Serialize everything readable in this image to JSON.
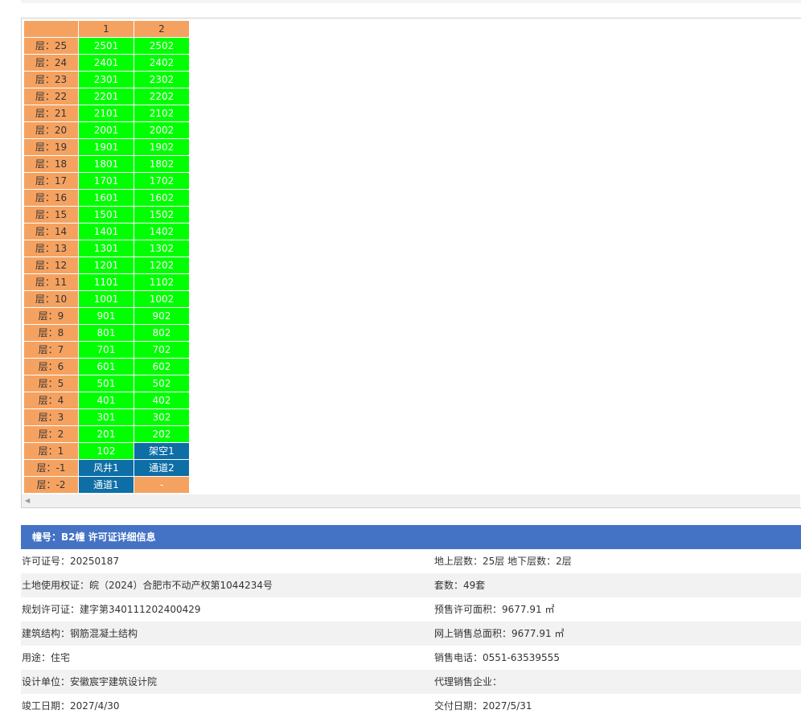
{
  "grid": {
    "column_headers": [
      "",
      "1",
      "2"
    ],
    "colors": {
      "floor": "#f5a261",
      "available": "#00ff00",
      "other": "#0e6ea6",
      "empty": "#f5a261"
    },
    "rows": [
      {
        "floor": "层：25",
        "units": [
          {
            "text": "2501",
            "status": "available"
          },
          {
            "text": "2502",
            "status": "available"
          }
        ]
      },
      {
        "floor": "层：24",
        "units": [
          {
            "text": "2401",
            "status": "available"
          },
          {
            "text": "2402",
            "status": "available"
          }
        ]
      },
      {
        "floor": "层：23",
        "units": [
          {
            "text": "2301",
            "status": "available"
          },
          {
            "text": "2302",
            "status": "available"
          }
        ]
      },
      {
        "floor": "层：22",
        "units": [
          {
            "text": "2201",
            "status": "available"
          },
          {
            "text": "2202",
            "status": "available"
          }
        ]
      },
      {
        "floor": "层：21",
        "units": [
          {
            "text": "2101",
            "status": "available"
          },
          {
            "text": "2102",
            "status": "available"
          }
        ]
      },
      {
        "floor": "层：20",
        "units": [
          {
            "text": "2001",
            "status": "available"
          },
          {
            "text": "2002",
            "status": "available"
          }
        ]
      },
      {
        "floor": "层：19",
        "units": [
          {
            "text": "1901",
            "status": "available"
          },
          {
            "text": "1902",
            "status": "available"
          }
        ]
      },
      {
        "floor": "层：18",
        "units": [
          {
            "text": "1801",
            "status": "available"
          },
          {
            "text": "1802",
            "status": "available"
          }
        ]
      },
      {
        "floor": "层：17",
        "units": [
          {
            "text": "1701",
            "status": "available"
          },
          {
            "text": "1702",
            "status": "available"
          }
        ]
      },
      {
        "floor": "层：16",
        "units": [
          {
            "text": "1601",
            "status": "available"
          },
          {
            "text": "1602",
            "status": "available"
          }
        ]
      },
      {
        "floor": "层：15",
        "units": [
          {
            "text": "1501",
            "status": "available"
          },
          {
            "text": "1502",
            "status": "available"
          }
        ]
      },
      {
        "floor": "层：14",
        "units": [
          {
            "text": "1401",
            "status": "available"
          },
          {
            "text": "1402",
            "status": "available"
          }
        ]
      },
      {
        "floor": "层：13",
        "units": [
          {
            "text": "1301",
            "status": "available"
          },
          {
            "text": "1302",
            "status": "available"
          }
        ]
      },
      {
        "floor": "层：12",
        "units": [
          {
            "text": "1201",
            "status": "available"
          },
          {
            "text": "1202",
            "status": "available"
          }
        ]
      },
      {
        "floor": "层：11",
        "units": [
          {
            "text": "1101",
            "status": "available"
          },
          {
            "text": "1102",
            "status": "available"
          }
        ]
      },
      {
        "floor": "层：10",
        "units": [
          {
            "text": "1001",
            "status": "available"
          },
          {
            "text": "1002",
            "status": "available"
          }
        ]
      },
      {
        "floor": "层：9",
        "units": [
          {
            "text": "901",
            "status": "available"
          },
          {
            "text": "902",
            "status": "available"
          }
        ]
      },
      {
        "floor": "层：8",
        "units": [
          {
            "text": "801",
            "status": "available"
          },
          {
            "text": "802",
            "status": "available"
          }
        ]
      },
      {
        "floor": "层：7",
        "units": [
          {
            "text": "701",
            "status": "available"
          },
          {
            "text": "702",
            "status": "available"
          }
        ]
      },
      {
        "floor": "层：6",
        "units": [
          {
            "text": "601",
            "status": "available"
          },
          {
            "text": "602",
            "status": "available"
          }
        ]
      },
      {
        "floor": "层：5",
        "units": [
          {
            "text": "501",
            "status": "available"
          },
          {
            "text": "502",
            "status": "available"
          }
        ]
      },
      {
        "floor": "层：4",
        "units": [
          {
            "text": "401",
            "status": "available"
          },
          {
            "text": "402",
            "status": "available"
          }
        ]
      },
      {
        "floor": "层：3",
        "units": [
          {
            "text": "301",
            "status": "available"
          },
          {
            "text": "302",
            "status": "available"
          }
        ]
      },
      {
        "floor": "层：2",
        "units": [
          {
            "text": "201",
            "status": "available"
          },
          {
            "text": "202",
            "status": "available"
          }
        ]
      },
      {
        "floor": "层：1",
        "units": [
          {
            "text": "102",
            "status": "available"
          },
          {
            "text": "架空1",
            "status": "other"
          }
        ]
      },
      {
        "floor": "层：-1",
        "units": [
          {
            "text": "风井1",
            "status": "other"
          },
          {
            "text": "通道2",
            "status": "other"
          }
        ]
      },
      {
        "floor": "层：-2",
        "units": [
          {
            "text": "通道1",
            "status": "other"
          },
          {
            "text": "-",
            "status": "empty"
          }
        ]
      }
    ]
  },
  "scrollbar": {
    "left_arrow_icon": "triangle-left"
  },
  "info": {
    "header": "幢号：B2幢 许可证详细信息",
    "header_color": "#4472c4",
    "rows": [
      {
        "left": "许可证号：20250187",
        "right": "地上层数：25层  地下层数：2层"
      },
      {
        "left": "土地使用权证：皖（2024）合肥市不动产权第1044234号",
        "right": "套数：49套"
      },
      {
        "left": "规划许可证：建字第340111202400429",
        "right": "预售许可面积：9677.91 ㎡"
      },
      {
        "left": "建筑结构：钢筋混凝土结构",
        "right": "网上销售总面积：9677.91 ㎡"
      },
      {
        "left": "用途：住宅",
        "right": "销售电话：0551-63539555"
      },
      {
        "left": "设计单位：安徽宸宇建筑设计院",
        "right": "代理销售企业："
      },
      {
        "left": "竣工日期：2027/4/30",
        "right": "交付日期：2027/5/31"
      }
    ]
  }
}
